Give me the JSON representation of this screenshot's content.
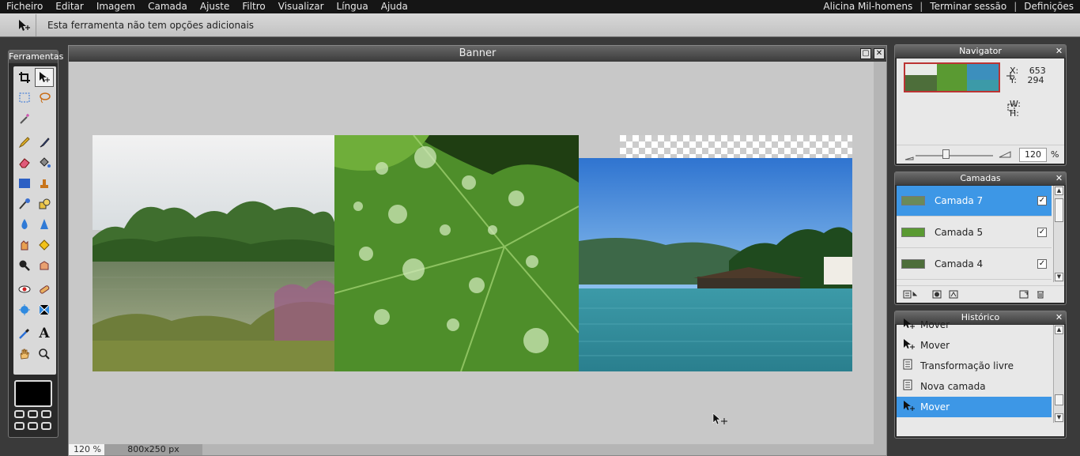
{
  "menu": {
    "items": [
      "Ficheiro",
      "Editar",
      "Imagem",
      "Camada",
      "Ajuste",
      "Filtro",
      "Visualizar",
      "Língua",
      "Ajuda"
    ],
    "user": "Alicina Mil-homens",
    "logout": "Terminar sessão",
    "settings": "Definições",
    "separator": "|"
  },
  "options_bar": {
    "text": "Esta ferramenta não tem opções adicionais"
  },
  "toolbox": {
    "title": "Ferramentas"
  },
  "document": {
    "title": "Banner",
    "zoom": "120 %",
    "dimensions": "800x250 px"
  },
  "navigator": {
    "title": "Navigator",
    "x_label": "X:",
    "x_value": "653",
    "y_label": "Y:",
    "y_value": "294",
    "w_label": "W:",
    "h_label": "H:",
    "zoom_value": "120",
    "zoom_unit": "%"
  },
  "layers": {
    "title": "Camadas",
    "items": [
      {
        "name": "Camada 7",
        "selected": true,
        "checked": "✓"
      },
      {
        "name": "Camada 5",
        "selected": false,
        "checked": "✓"
      },
      {
        "name": "Camada 4",
        "selected": false,
        "checked": "✓"
      }
    ]
  },
  "history": {
    "title": "Histórico",
    "items": [
      {
        "label": "Mover",
        "icon": "move-icon"
      },
      {
        "label": "Mover",
        "icon": "move-icon"
      },
      {
        "label": "Transformação livre",
        "icon": "document-icon"
      },
      {
        "label": "Nova camada",
        "icon": "document-icon"
      },
      {
        "label": "Mover",
        "icon": "move-icon",
        "selected": true
      }
    ]
  },
  "colors": {
    "accent": "#3d97e6",
    "foreground": "#000000"
  }
}
